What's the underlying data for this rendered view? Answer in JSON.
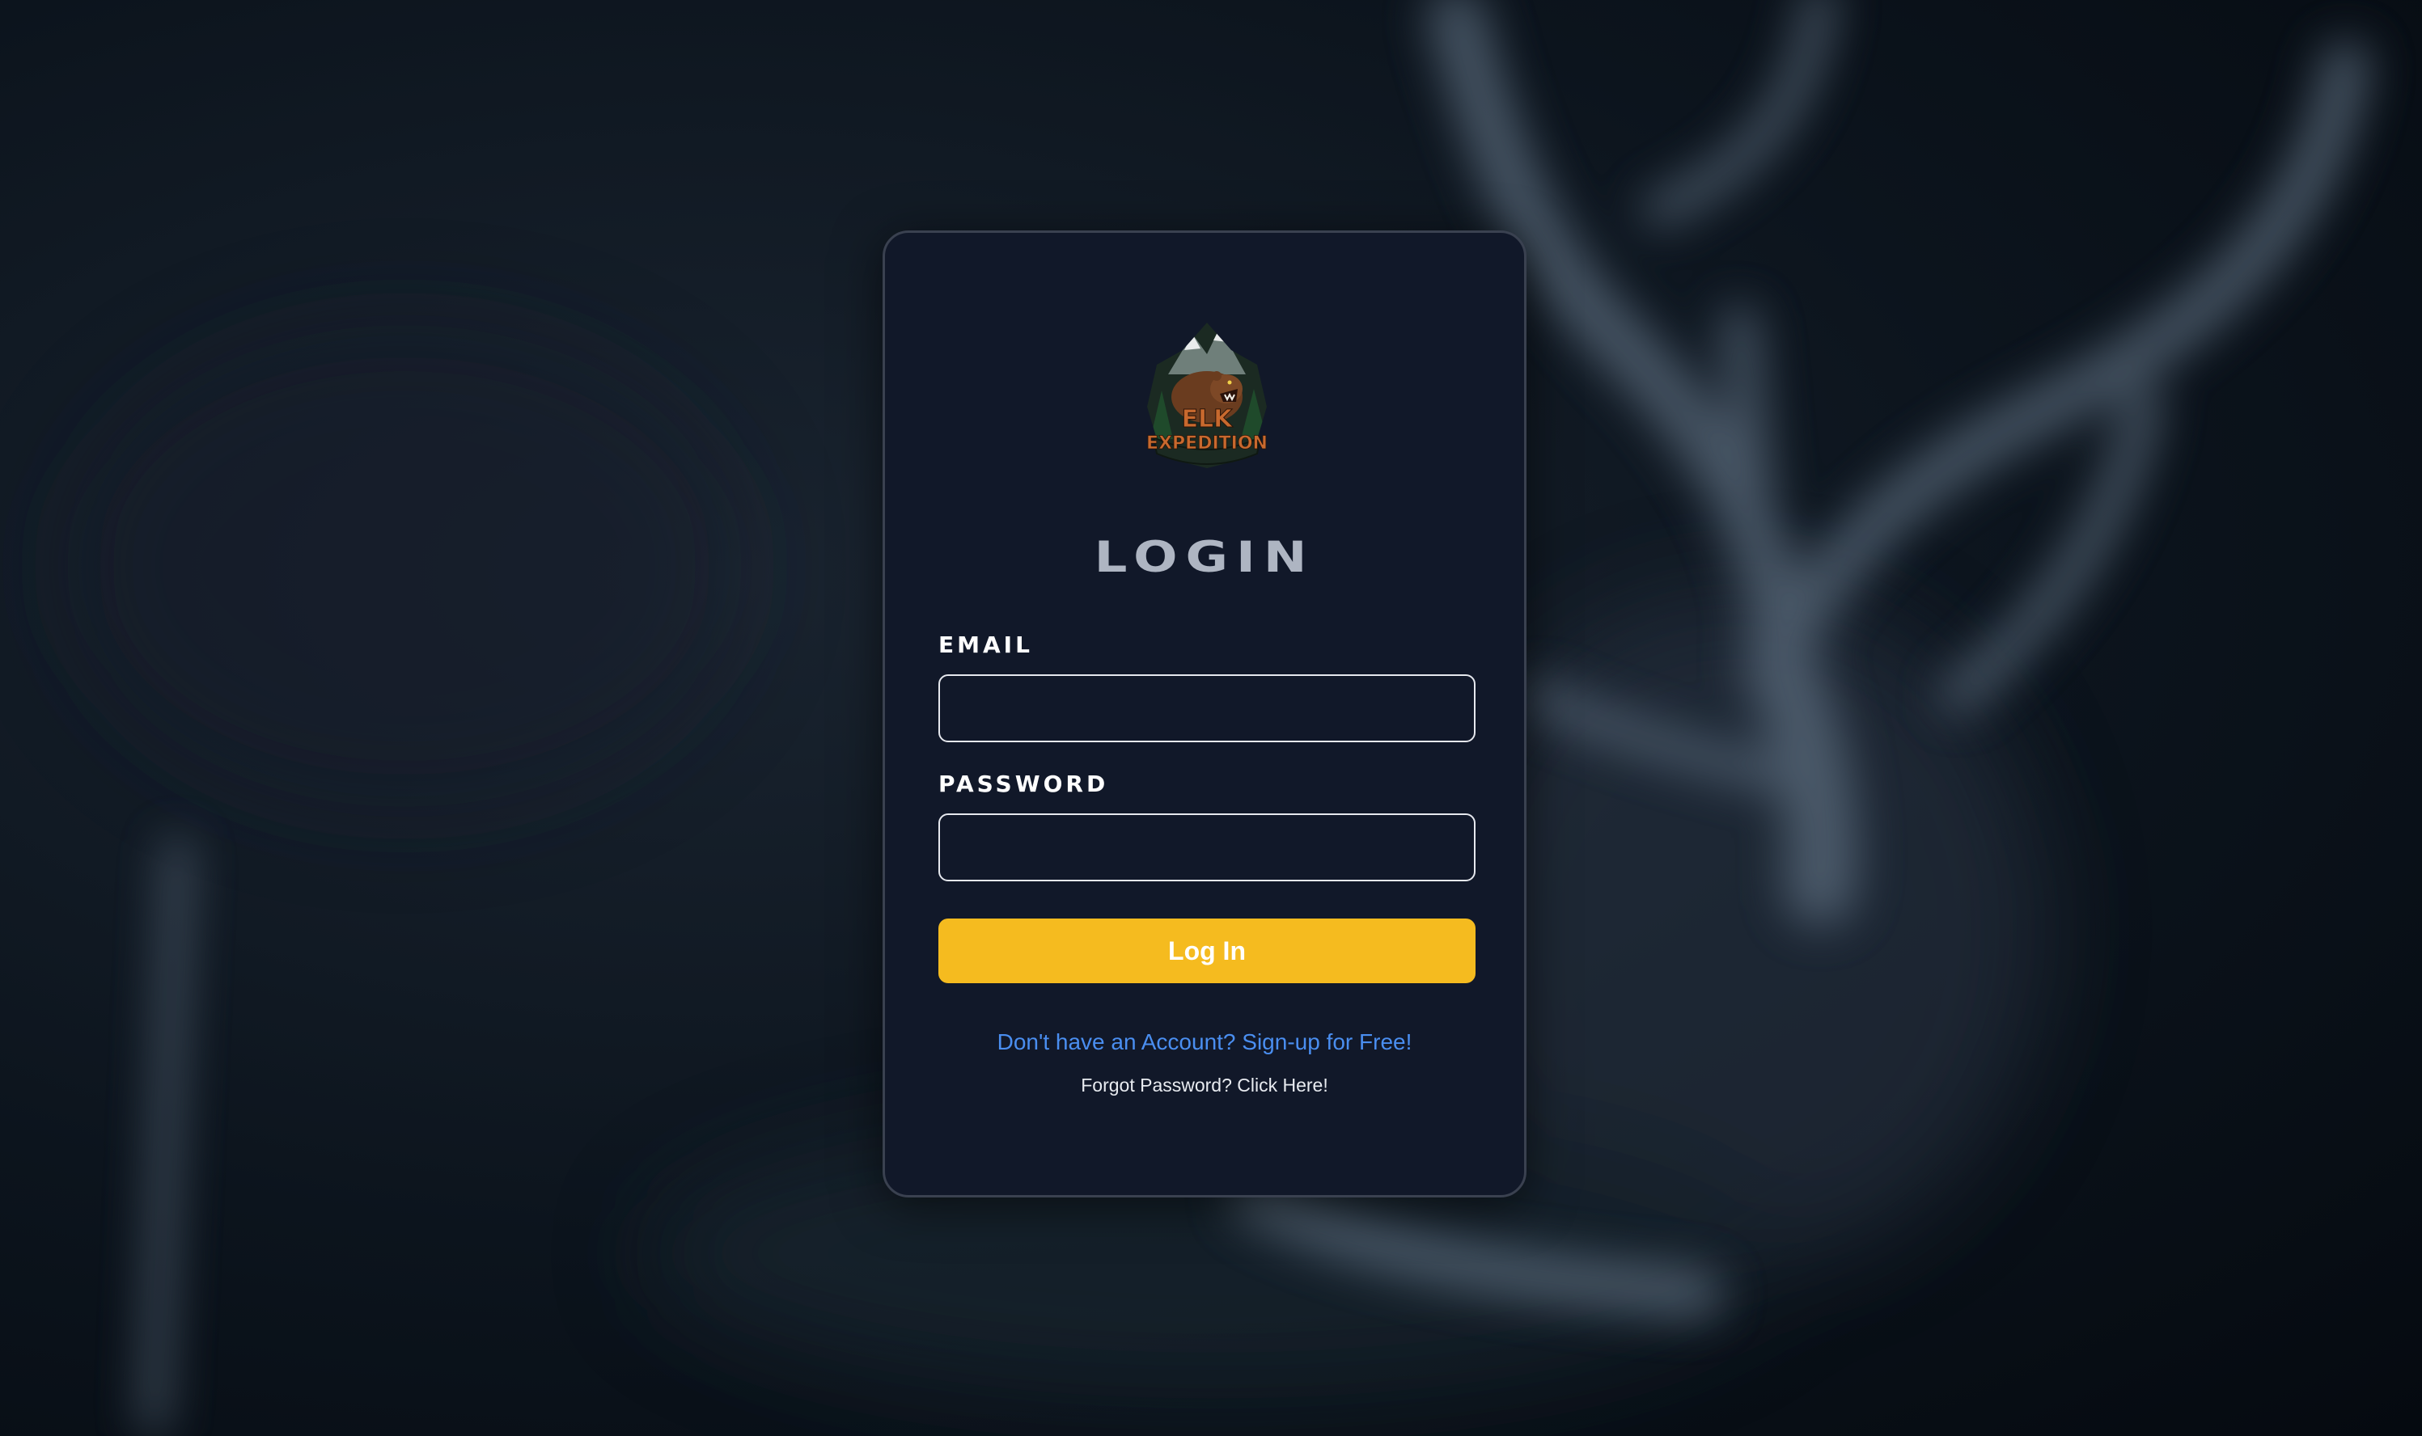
{
  "login": {
    "logo_text_line1": "ELK",
    "logo_text_line2": "EXPEDITION",
    "title": "LOGIN",
    "email_label": "EMAIL",
    "email_value": "",
    "password_label": "PASSWORD",
    "password_value": "",
    "submit_label": "Log In",
    "signup_link": "Don't have an Account? Sign-up for Free!",
    "forgot_link": "Forgot Password? Click Here!"
  },
  "colors": {
    "card_background": "#111829",
    "button_accent": "#f5bb1f",
    "link_blue": "#4a8ef0",
    "title_gray": "#aeb5c2"
  }
}
